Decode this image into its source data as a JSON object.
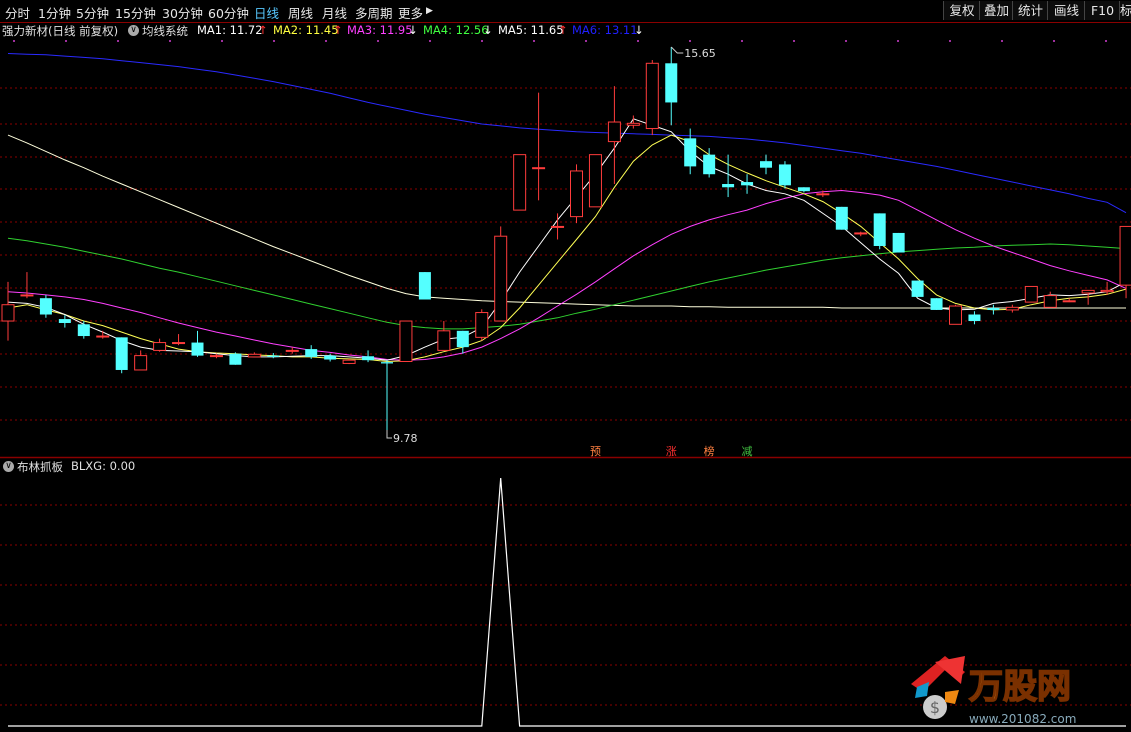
{
  "toolbar": {
    "periods": [
      "分时",
      "1分钟",
      "5分钟",
      "15分钟",
      "30分钟",
      "60分钟",
      "日线",
      "周线",
      "月线",
      "多周期",
      "更多"
    ],
    "active_period": "日线",
    "more_arrow": "▶",
    "right_buttons": [
      "复权",
      "叠加",
      "统计",
      "画线",
      "F10",
      "标"
    ]
  },
  "info_bar": {
    "stock_title": "强力新材(日线 前复权)",
    "indicator_name": "均线系统",
    "ma": [
      {
        "label": "MA1: 11.72",
        "arrow": "↑",
        "color": "#ffffff",
        "arrow_color": "#ff3030"
      },
      {
        "label": "MA2: 11.45",
        "arrow": "↑",
        "color": "#ffff40",
        "arrow_color": "#ff3030"
      },
      {
        "label": "MA3: 11.95",
        "arrow": "↓",
        "color": "#ff40ff",
        "arrow_color": "#ffffff"
      },
      {
        "label": "MA4: 12.56",
        "arrow": "↓",
        "color": "#40ff40",
        "arrow_color": "#ffffff"
      },
      {
        "label": "MA5: 11.65",
        "arrow": "↑",
        "color": "#ffffff",
        "arrow_color": "#ff3030"
      },
      {
        "label": "MA6: 13.11",
        "arrow": "↓",
        "color": "#2020ff",
        "arrow_color": "#ffffff"
      }
    ]
  },
  "annotations": {
    "high_label": "15.65",
    "low_label": "9.78",
    "markers": [
      {
        "text": "预",
        "color": "#ff8040"
      },
      {
        "text": "涨",
        "color": "#ff3030"
      },
      {
        "text": "榜",
        "color": "#ff8040"
      },
      {
        "text": "减",
        "color": "#40c040"
      }
    ]
  },
  "indicator_panel": {
    "name": "布林抓板",
    "value_label": "BLXG: 0.00"
  },
  "colors": {
    "up": "#ff3c3c",
    "down": "#54ffff",
    "grid": "#8a0000",
    "ma1": "#ffffff",
    "ma2": "#ffff55",
    "ma3": "#ff40ff",
    "ma4": "#30d030",
    "ma5": "#ffffdd",
    "ma6": "#2a2aff"
  },
  "watermark": {
    "brand": "万股网",
    "url": "www.201082.com"
  },
  "chart_data": {
    "type": "candlestick",
    "ohlc": [
      [
        11.45,
        12.05,
        11.15,
        11.7
      ],
      [
        11.85,
        12.2,
        11.8,
        11.85
      ],
      [
        11.8,
        11.85,
        11.5,
        11.55
      ],
      [
        11.48,
        11.54,
        11.35,
        11.42
      ],
      [
        11.4,
        11.45,
        11.18,
        11.22
      ],
      [
        11.22,
        11.3,
        11.18,
        11.22
      ],
      [
        11.2,
        11.2,
        10.65,
        10.7
      ],
      [
        10.7,
        11.0,
        10.7,
        10.92
      ],
      [
        11.0,
        11.18,
        10.98,
        11.12
      ],
      [
        11.12,
        11.25,
        11.08,
        11.12
      ],
      [
        11.12,
        11.3,
        10.9,
        10.92
      ],
      [
        10.92,
        10.95,
        10.88,
        10.92
      ],
      [
        10.95,
        10.97,
        10.78,
        10.78
      ],
      [
        10.9,
        10.97,
        10.9,
        10.94
      ],
      [
        10.92,
        10.96,
        10.88,
        10.9
      ],
      [
        11.0,
        11.05,
        10.95,
        11.0
      ],
      [
        11.02,
        11.08,
        10.87,
        10.9
      ],
      [
        10.92,
        10.95,
        10.83,
        10.86
      ],
      [
        10.8,
        10.87,
        10.79,
        10.85
      ],
      [
        10.91,
        11.0,
        10.82,
        10.85
      ],
      [
        10.82,
        10.85,
        9.78,
        10.8
      ],
      [
        10.83,
        11.45,
        10.83,
        11.45
      ],
      [
        12.2,
        12.2,
        11.78,
        11.78
      ],
      [
        11.0,
        11.45,
        11.0,
        11.3
      ],
      [
        11.3,
        11.3,
        10.95,
        11.05
      ],
      [
        11.2,
        11.63,
        11.15,
        11.58
      ],
      [
        11.45,
        12.9,
        11.45,
        12.75
      ],
      [
        13.15,
        13.15,
        13.15,
        14.0
      ],
      [
        13.8,
        14.95,
        13.3,
        13.8
      ],
      [
        12.9,
        13.1,
        12.7,
        12.9
      ],
      [
        13.05,
        13.85,
        12.95,
        13.75
      ],
      [
        13.2,
        14.0,
        13.2,
        14.0
      ],
      [
        14.2,
        15.05,
        13.55,
        14.5
      ],
      [
        14.45,
        14.6,
        14.4,
        14.48
      ],
      [
        14.4,
        15.45,
        14.3,
        15.4
      ],
      [
        15.4,
        15.65,
        14.45,
        14.8
      ],
      [
        14.25,
        14.4,
        13.7,
        13.82
      ],
      [
        14.0,
        14.1,
        13.65,
        13.7
      ],
      [
        13.55,
        14.0,
        13.35,
        13.5
      ],
      [
        13.58,
        13.7,
        13.4,
        13.53
      ],
      [
        13.9,
        14.0,
        13.7,
        13.8
      ],
      [
        13.85,
        13.9,
        13.48,
        13.53
      ],
      [
        13.5,
        13.5,
        13.42,
        13.44
      ],
      [
        13.4,
        13.45,
        13.35,
        13.4
      ],
      [
        13.2,
        13.2,
        12.85,
        12.85
      ],
      [
        12.8,
        12.82,
        12.75,
        12.8
      ],
      [
        13.1,
        13.1,
        12.55,
        12.6
      ],
      [
        12.8,
        12.8,
        12.5,
        12.5
      ],
      [
        12.07,
        12.07,
        11.82,
        11.82
      ],
      [
        11.8,
        11.8,
        11.62,
        11.62
      ],
      [
        11.4,
        11.7,
        11.4,
        11.68
      ],
      [
        11.55,
        11.6,
        11.4,
        11.45
      ],
      [
        11.65,
        11.7,
        11.55,
        11.62
      ],
      [
        11.62,
        11.7,
        11.58,
        11.66
      ],
      [
        11.74,
        11.98,
        11.74,
        11.98
      ],
      [
        11.66,
        11.9,
        11.66,
        11.84
      ],
      [
        11.76,
        11.8,
        11.74,
        11.76
      ],
      [
        11.88,
        11.88,
        11.7,
        11.92
      ],
      [
        11.9,
        12.05,
        11.85,
        11.92
      ],
      [
        12.0,
        12.9,
        11.8,
        12.9
      ]
    ],
    "ma1": [
      11.74,
      11.72,
      11.66,
      11.55,
      11.4,
      11.28,
      11.15,
      11.05,
      11.0,
      10.99,
      10.98,
      10.95,
      10.92,
      10.9,
      10.9,
      10.91,
      10.92,
      10.92,
      10.9,
      10.88,
      10.85,
      10.92,
      11.05,
      11.17,
      11.2,
      11.35,
      11.75,
      12.2,
      12.6,
      13.0,
      13.35,
      13.7,
      14.1,
      14.55,
      14.45,
      14.35,
      14.05,
      13.82,
      13.7,
      13.55,
      13.45,
      13.4,
      13.3,
      13.1,
      12.9,
      12.65,
      12.4,
      12.18,
      11.8,
      11.65,
      11.62,
      11.63,
      11.72,
      11.75,
      11.8,
      11.85,
      11.84,
      11.86,
      11.9,
      12.05
    ],
    "ma2": [
      11.65,
      11.7,
      11.62,
      11.55,
      11.45,
      11.38,
      11.28,
      11.18,
      11.1,
      11.02,
      10.98,
      10.96,
      10.95,
      10.93,
      10.92,
      10.9,
      10.9,
      10.88,
      10.87,
      10.86,
      10.83,
      10.84,
      10.9,
      10.98,
      11.05,
      11.15,
      11.35,
      11.65,
      12.0,
      12.35,
      12.7,
      13.05,
      13.5,
      13.9,
      14.15,
      14.3,
      14.2,
      14.0,
      13.85,
      13.72,
      13.6,
      13.5,
      13.4,
      13.28,
      13.1,
      12.9,
      12.65,
      12.4,
      12.1,
      11.85,
      11.72,
      11.65,
      11.62,
      11.63,
      11.7,
      11.76,
      11.8,
      11.82,
      11.86,
      11.94
    ],
    "ma3": [
      11.9,
      11.88,
      11.85,
      11.82,
      11.78,
      11.72,
      11.65,
      11.58,
      11.5,
      11.42,
      11.35,
      11.28,
      11.22,
      11.16,
      11.1,
      11.05,
      11.0,
      10.97,
      10.93,
      10.9,
      10.86,
      10.85,
      10.86,
      10.9,
      10.96,
      11.05,
      11.18,
      11.33,
      11.5,
      11.68,
      11.86,
      12.05,
      12.25,
      12.45,
      12.62,
      12.78,
      12.9,
      13.0,
      13.08,
      13.15,
      13.25,
      13.33,
      13.4,
      13.43,
      13.45,
      13.42,
      13.38,
      13.3,
      13.15,
      13.0,
      12.85,
      12.72,
      12.6,
      12.5,
      12.4,
      12.3,
      12.22,
      12.15,
      12.08,
      11.95
    ],
    "ma4": [
      12.72,
      12.68,
      12.63,
      12.58,
      12.52,
      12.46,
      12.4,
      12.33,
      12.26,
      12.2,
      12.13,
      12.06,
      11.99,
      11.92,
      11.85,
      11.78,
      11.71,
      11.64,
      11.57,
      11.5,
      11.43,
      11.38,
      11.35,
      11.33,
      11.33,
      11.35,
      11.37,
      11.4,
      11.45,
      11.5,
      11.57,
      11.63,
      11.7,
      11.77,
      11.84,
      11.91,
      11.98,
      12.05,
      12.11,
      12.17,
      12.23,
      12.28,
      12.33,
      12.38,
      12.42,
      12.45,
      12.48,
      12.51,
      12.53,
      12.55,
      12.57,
      12.58,
      12.6,
      12.61,
      12.62,
      12.63,
      12.62,
      12.6,
      12.58,
      12.56
    ],
    "ma5": [
      14.3,
      14.18,
      14.05,
      13.92,
      13.8,
      13.67,
      13.55,
      13.43,
      13.31,
      13.19,
      13.07,
      12.95,
      12.83,
      12.71,
      12.59,
      12.48,
      12.37,
      12.26,
      12.15,
      12.05,
      11.95,
      11.87,
      11.82,
      11.8,
      11.78,
      11.76,
      11.75,
      11.74,
      11.73,
      11.72,
      11.71,
      11.7,
      11.69,
      11.68,
      11.68,
      11.68,
      11.67,
      11.67,
      11.66,
      11.66,
      11.66,
      11.66,
      11.66,
      11.66,
      11.65,
      11.65,
      11.65,
      11.65,
      11.65,
      11.65,
      11.65,
      11.65,
      11.65,
      11.65,
      11.65,
      11.65,
      11.65,
      11.65,
      11.65,
      11.65
    ],
    "ma6": [
      15.55,
      15.54,
      15.53,
      15.51,
      15.49,
      15.47,
      15.44,
      15.41,
      15.38,
      15.35,
      15.31,
      15.27,
      15.22,
      15.17,
      15.12,
      15.06,
      15.0,
      14.94,
      14.87,
      14.8,
      14.74,
      14.68,
      14.62,
      14.57,
      14.52,
      14.47,
      14.44,
      14.41,
      14.39,
      14.37,
      14.35,
      14.34,
      14.33,
      14.32,
      14.31,
      14.3,
      14.29,
      14.28,
      14.26,
      14.24,
      14.21,
      14.18,
      14.14,
      14.1,
      14.06,
      14.02,
      13.97,
      13.92,
      13.87,
      13.82,
      13.76,
      13.7,
      13.64,
      13.58,
      13.52,
      13.46,
      13.4,
      13.33,
      13.27,
      13.11
    ],
    "blxg": [
      0,
      0,
      0,
      0,
      0,
      0,
      0,
      0,
      0,
      0,
      0,
      0,
      0,
      0,
      0,
      0,
      0,
      0,
      0,
      0,
      0,
      0,
      0,
      0,
      0,
      0,
      1,
      0,
      0,
      0,
      0,
      0,
      0,
      0,
      0,
      0,
      0,
      0,
      0,
      0,
      0,
      0,
      0,
      0,
      0,
      0,
      0,
      0,
      0,
      0,
      0,
      0,
      0,
      0,
      0,
      0,
      0,
      0,
      0,
      0
    ],
    "marker_index": [
      31,
      35,
      37,
      39
    ],
    "high_index": 35,
    "low_index": 20
  }
}
